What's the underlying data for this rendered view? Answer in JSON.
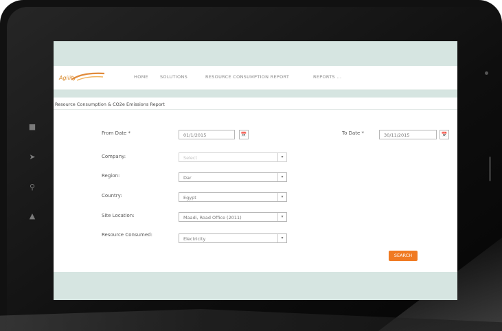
{
  "nav": {
    "logo_text": "Agility",
    "items": [
      "HOME",
      "SOLUTIONS",
      "RESOURCE CONSUMPTION REPORT",
      "REPORTS ..."
    ]
  },
  "page": {
    "subtitle": "Resource Consumption & CO2e Emissions Report"
  },
  "form": {
    "from_date_label": "From Date *",
    "from_date_value": "01/1/2015",
    "to_date_label": "To Date *",
    "to_date_value": "30/11/2015",
    "company_label": "Company:",
    "company_value": "Select",
    "region_label": "Region:",
    "region_value": "Dar",
    "country_label": "Country:",
    "country_value": "Egypt",
    "site_location_label": "Site Location:",
    "site_location_value": "Maadi, Road Office (2011)",
    "resource_label": "Resource Consumed:",
    "resource_value": "Electricity",
    "search_label": "SEARCH"
  },
  "colors": {
    "band": "#d6e5e1",
    "accent": "#f07a22"
  }
}
